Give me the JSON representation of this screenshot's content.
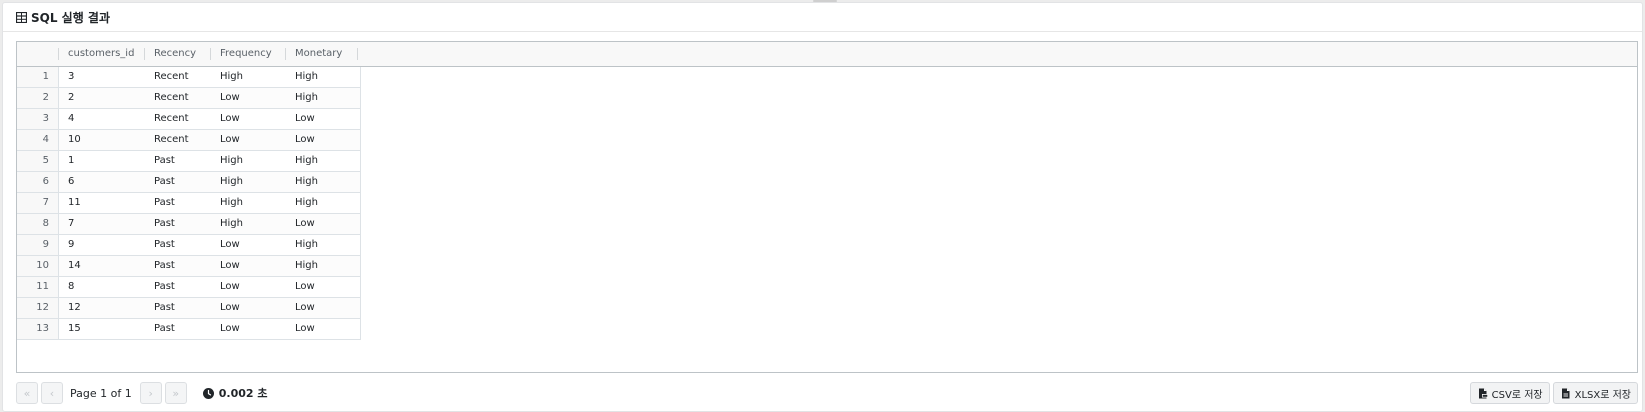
{
  "panel": {
    "title": "SQL 실행 결과"
  },
  "grid": {
    "columns": [
      "customers_id",
      "Recency",
      "Frequency",
      "Monetary"
    ],
    "rows": [
      {
        "n": "1",
        "id": "3",
        "recency": "Recent",
        "frequency": "High",
        "monetary": "High"
      },
      {
        "n": "2",
        "id": "2",
        "recency": "Recent",
        "frequency": "Low",
        "monetary": "High"
      },
      {
        "n": "3",
        "id": "4",
        "recency": "Recent",
        "frequency": "Low",
        "monetary": "Low"
      },
      {
        "n": "4",
        "id": "10",
        "recency": "Recent",
        "frequency": "Low",
        "monetary": "Low"
      },
      {
        "n": "5",
        "id": "1",
        "recency": "Past",
        "frequency": "High",
        "monetary": "High"
      },
      {
        "n": "6",
        "id": "6",
        "recency": "Past",
        "frequency": "High",
        "monetary": "High"
      },
      {
        "n": "7",
        "id": "11",
        "recency": "Past",
        "frequency": "High",
        "monetary": "High"
      },
      {
        "n": "8",
        "id": "7",
        "recency": "Past",
        "frequency": "High",
        "monetary": "Low"
      },
      {
        "n": "9",
        "id": "9",
        "recency": "Past",
        "frequency": "Low",
        "monetary": "High"
      },
      {
        "n": "10",
        "id": "14",
        "recency": "Past",
        "frequency": "Low",
        "monetary": "High"
      },
      {
        "n": "11",
        "id": "8",
        "recency": "Past",
        "frequency": "Low",
        "monetary": "Low"
      },
      {
        "n": "12",
        "id": "12",
        "recency": "Past",
        "frequency": "Low",
        "monetary": "Low"
      },
      {
        "n": "13",
        "id": "15",
        "recency": "Past",
        "frequency": "Low",
        "monetary": "Low"
      }
    ]
  },
  "footer": {
    "first_icon": "«",
    "prev_icon": "‹",
    "next_icon": "›",
    "last_icon": "»",
    "page_label": "Page 1 of 1",
    "timing": "0.002 초",
    "csv_label": "CSV로 저장",
    "xlsx_label": "XLSX로 저장"
  },
  "icons": {
    "title": "table-icon",
    "timing": "clock-icon",
    "csv": "csv-file-icon",
    "xlsx": "file-icon"
  }
}
